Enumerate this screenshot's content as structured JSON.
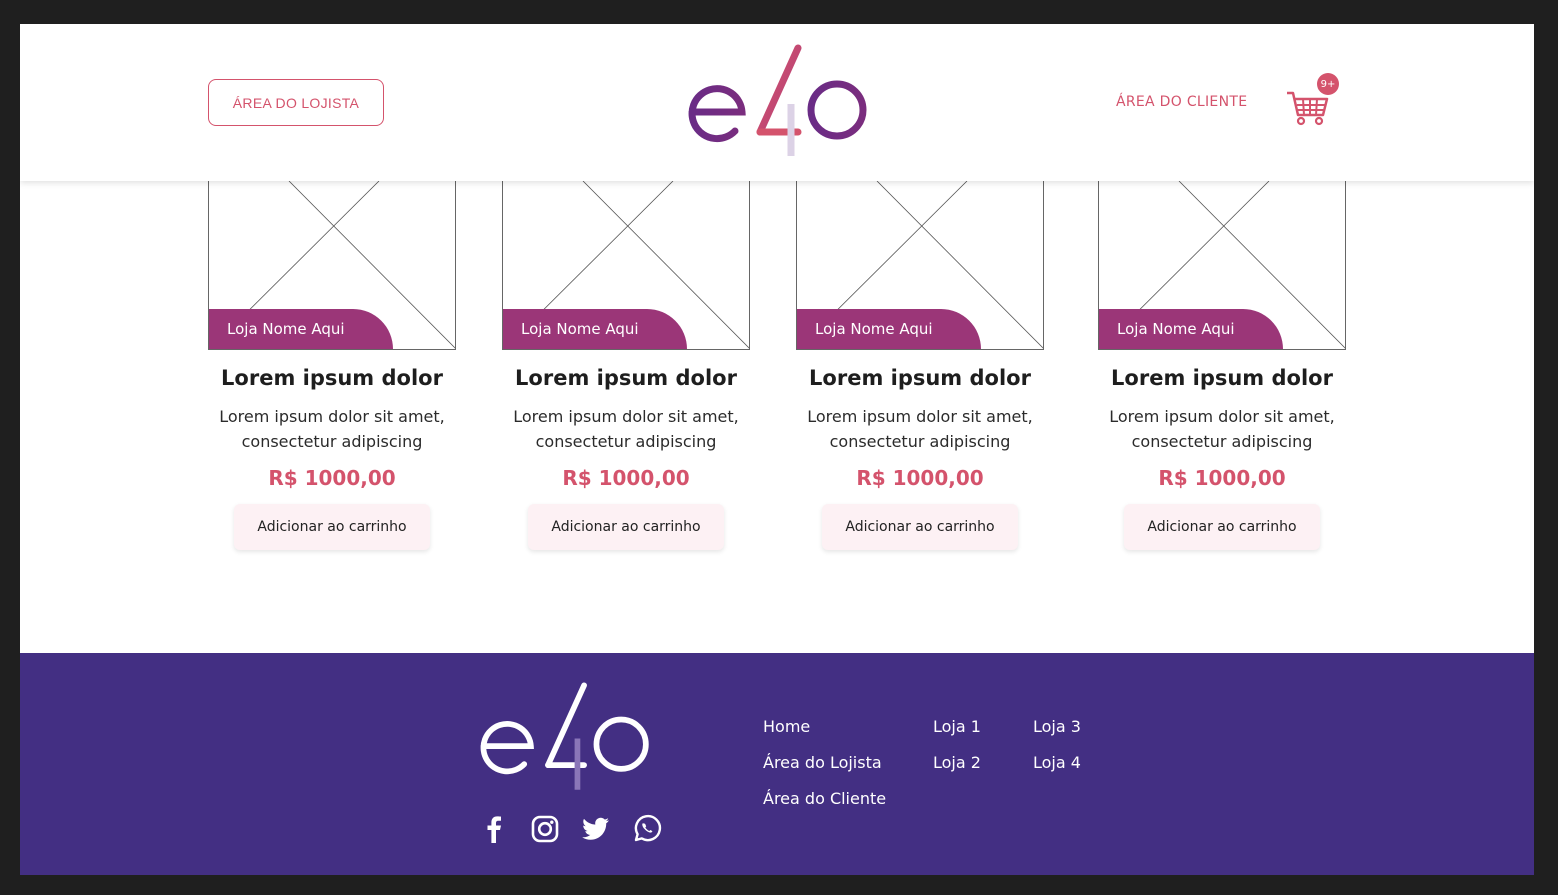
{
  "header": {
    "store_area_label": "ÁREA DO LOJISTA",
    "customer_area_label": "ÁREA DO CLIENTE",
    "cart_badge": "9+",
    "logo_text": "e4o"
  },
  "products": [
    {
      "store": "Loja Nome Aqui",
      "title": "Lorem ipsum dolor",
      "desc1": "Lorem ipsum dolor sit amet,",
      "desc2": "consectetur adipiscing",
      "price": "R$ 1000,00",
      "button": "Adicionar ao carrinho"
    },
    {
      "store": "Loja Nome Aqui",
      "title": "Lorem ipsum dolor",
      "desc1": "Lorem ipsum dolor sit amet,",
      "desc2": "consectetur adipiscing",
      "price": "R$ 1000,00",
      "button": "Adicionar ao carrinho"
    },
    {
      "store": "Loja Nome Aqui",
      "title": "Lorem ipsum dolor",
      "desc1": "Lorem ipsum dolor sit amet,",
      "desc2": "consectetur adipiscing",
      "price": "R$ 1000,00",
      "button": "Adicionar ao carrinho"
    },
    {
      "store": "Loja Nome Aqui",
      "title": "Lorem ipsum dolor",
      "desc1": "Lorem ipsum dolor sit amet,",
      "desc2": "consectetur adipiscing",
      "price": "R$ 1000,00",
      "button": "Adicionar ao carrinho"
    }
  ],
  "footer": {
    "logo_text": "e4o",
    "nav_col1": [
      "Home",
      "Área do Lojista",
      "Área do Cliente"
    ],
    "nav_col2": [
      "Loja 1",
      "Loja 2"
    ],
    "nav_col3": [
      "Loja 3",
      "Loja 4"
    ],
    "social_icons": [
      "facebook-icon",
      "instagram-icon",
      "twitter-icon",
      "whatsapp-icon"
    ]
  },
  "colors": {
    "accent": "#d4536c",
    "store_tag": "#9b3678",
    "footer_bg": "#432f83",
    "button_bg": "#fdf1f4"
  }
}
